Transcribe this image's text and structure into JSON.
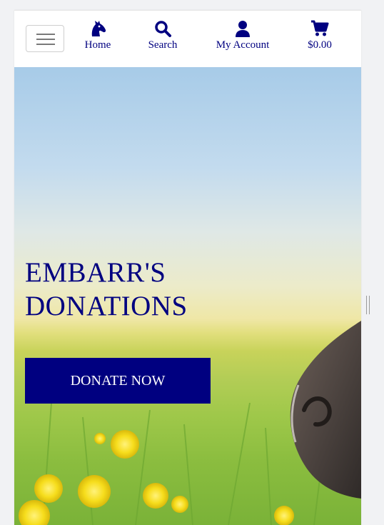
{
  "nav": {
    "toggler_label": "Toggle navigation",
    "items": [
      {
        "label": "Home",
        "icon": "horse-head-icon"
      },
      {
        "label": "Search",
        "icon": "search-icon"
      },
      {
        "label": "My Account",
        "icon": "user-icon"
      },
      {
        "label": "$0.00",
        "icon": "shopping-cart-icon"
      }
    ]
  },
  "hero": {
    "title_line1": "EMBARR'S",
    "title_line2": "DONATIONS",
    "donate_label": "DONATE NOW"
  },
  "colors": {
    "brand": "#000080",
    "background": "#ffffff"
  }
}
